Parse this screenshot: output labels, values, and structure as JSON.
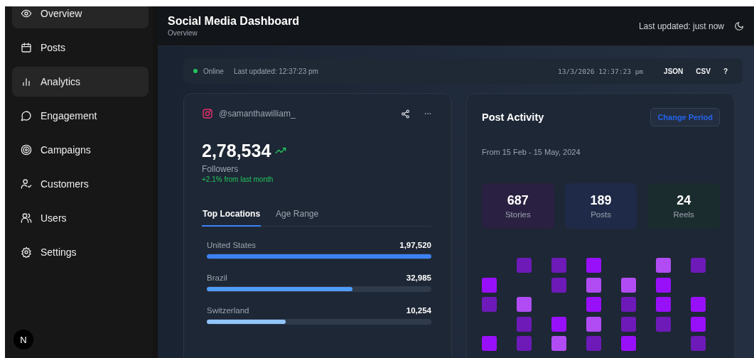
{
  "sidebar": {
    "items": [
      {
        "label": "Overview",
        "selected": true
      },
      {
        "label": "Posts",
        "selected": false
      },
      {
        "label": "Analytics",
        "selected": true
      },
      {
        "label": "Engagement",
        "selected": false
      },
      {
        "label": "Campaigns",
        "selected": false
      },
      {
        "label": "Customers",
        "selected": false
      },
      {
        "label": "Users",
        "selected": false
      },
      {
        "label": "Settings",
        "selected": false
      }
    ],
    "avatar": "N"
  },
  "header": {
    "title": "Social Media Dashboard",
    "subtitle": "Overview",
    "last_updated": "Last updated: just now"
  },
  "status_bar": {
    "status": "Online",
    "online": true,
    "last_updated": "Last updated: 12:37:23 pm",
    "datetime": "13/3/2026 12:37:23 pm",
    "actions": [
      "JSON",
      "CSV",
      "?"
    ]
  },
  "profile_card": {
    "handle": "@samanthawilliam_",
    "followers": "2,78,534",
    "followers_label": "Followers",
    "change": "+2.1% from last month",
    "tabs": [
      {
        "label": "Top Locations",
        "selected": true
      },
      {
        "label": "Age Range",
        "selected": false
      }
    ],
    "locations": [
      {
        "name": "United States",
        "value": "1,97,520",
        "level": 1.0,
        "color": "#3b82f6"
      },
      {
        "name": "Brazil",
        "value": "32,985",
        "level": 0.65,
        "color": "#4f9cf7"
      },
      {
        "name": "Switzerland",
        "value": "10,254",
        "level": 0.35,
        "color": "#93c5fd"
      }
    ]
  },
  "activity_card": {
    "title": "Post Activity",
    "button": "Change Period",
    "period": "From 15 Feb - 15 May, 2024",
    "stats": [
      {
        "value": "687",
        "label": "Stories",
        "color": "#2a2142"
      },
      {
        "value": "189",
        "label": "Posts",
        "color": "#1e2a47"
      },
      {
        "value": "24",
        "label": "Reels",
        "color": "#1b2c2e"
      }
    ],
    "heatmap": [
      [
        {
          "filled": false
        },
        {
          "filled": true,
          "color": "#6d1ab8"
        },
        {
          "filled": true,
          "color": "#6d1ab8"
        },
        {
          "filled": true,
          "color": "#9810fa"
        },
        {
          "filled": false
        },
        {
          "filled": true,
          "color": "#b14cf5"
        },
        {
          "filled": true,
          "color": "#6d1ab8"
        }
      ],
      [
        {
          "filled": true,
          "color": "#9810fa"
        },
        {
          "filled": false
        },
        {
          "filled": true,
          "color": "#6d1ab8"
        },
        {
          "filled": true,
          "color": "#b14cf5"
        },
        {
          "filled": true,
          "color": "#b14cf5"
        },
        {
          "filled": true,
          "color": "#9810fa"
        },
        {
          "filled": false
        }
      ],
      [
        {
          "filled": true,
          "color": "#6d1ab8"
        },
        {
          "filled": true,
          "color": "#b14cf5"
        },
        {
          "filled": false
        },
        {
          "filled": true,
          "color": "#9810fa"
        },
        {
          "filled": true,
          "color": "#6d1ab8"
        },
        {
          "filled": true,
          "color": "#9810fa"
        },
        {
          "filled": true,
          "color": "#9810fa"
        }
      ],
      [
        {
          "filled": false
        },
        {
          "filled": true,
          "color": "#6d1ab8"
        },
        {
          "filled": true,
          "color": "#9810fa"
        },
        {
          "filled": true,
          "color": "#b14cf5"
        },
        {
          "filled": true,
          "color": "#6d1ab8"
        },
        {
          "filled": true,
          "color": "#6d1ab8"
        },
        {
          "filled": true,
          "color": "#9810fa"
        }
      ],
      [
        {
          "filled": true,
          "color": "#9810fa"
        },
        {
          "filled": true,
          "color": "#6d1ab8"
        },
        {
          "filled": true,
          "color": "#b14cf5"
        },
        {
          "filled": true,
          "color": "#6d1ab8"
        },
        {
          "filled": true,
          "color": "#9810fa"
        },
        {
          "filled": false
        },
        {
          "filled": true,
          "color": "#6d1ab8"
        }
      ]
    ]
  }
}
